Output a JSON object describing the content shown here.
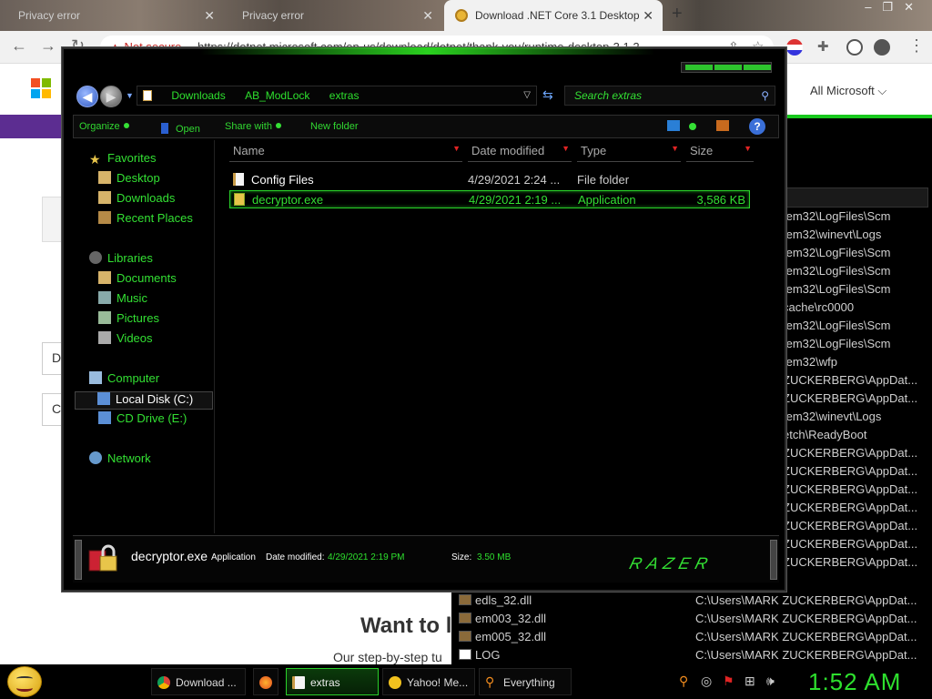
{
  "browser": {
    "tabs": [
      {
        "title": "Privacy error"
      },
      {
        "title": "Privacy error"
      },
      {
        "title": "Download .NET Core 3.1 Desktop"
      }
    ],
    "not_secure_label": "Not secure",
    "url": "https://dotnet.microsoft.com/en-us/download/dotnet/thank-you/runtime-desktop-3.1.2..."
  },
  "ms_page": {
    "all_microsoft": "All Microsoft",
    "box_letters": [
      "D",
      "C"
    ],
    "heading": "Want to l",
    "subtext": "Our step-by-step tu"
  },
  "bg_window": {
    "rows": [
      "tem32\\LogFiles\\Scm",
      "tem32\\winevt\\Logs",
      "tem32\\LogFiles\\Scm",
      "tem32\\LogFiles\\Scm",
      "tem32\\LogFiles\\Scm",
      "cache\\rc0000",
      "tem32\\LogFiles\\Scm",
      "tem32\\LogFiles\\Scm",
      "tem32\\wfp",
      "ZUCKERBERG\\AppDat...",
      "ZUCKERBERG\\AppDat...",
      "tem32\\winevt\\Logs",
      "etch\\ReadyBoot",
      "ZUCKERBERG\\AppDat...",
      "ZUCKERBERG\\AppDat...",
      "ZUCKERBERG\\AppDat...",
      "ZUCKERBERG\\AppDat...",
      "ZUCKERBERG\\AppDat...",
      "ZUCKERBERG\\AppDat...",
      "ZUCKERBERG\\AppDat..."
    ],
    "list": [
      {
        "name": "edls_32.dll",
        "path": "C:\\Users\\MARK ZUCKERBERG\\AppDat..."
      },
      {
        "name": "em003_32.dll",
        "path": "C:\\Users\\MARK ZUCKERBERG\\AppDat..."
      },
      {
        "name": "em005_32.dll",
        "path": "C:\\Users\\MARK ZUCKERBERG\\AppDat..."
      },
      {
        "name": "LOG",
        "path": "C:\\Users\\MARK ZUCKERBERG\\AppDat..."
      }
    ]
  },
  "explorer": {
    "breadcrumbs": [
      "Downloads",
      "AB_ModLock",
      "extras"
    ],
    "search_placeholder": "Search extras",
    "commands": {
      "organize": "Organize",
      "open": "Open",
      "share_with": "Share with",
      "new_folder": "New folder"
    },
    "nav": {
      "favorites": "Favorites",
      "desktop": "Desktop",
      "downloads": "Downloads",
      "recent_places": "Recent Places",
      "libraries": "Libraries",
      "documents": "Documents",
      "music": "Music",
      "pictures": "Pictures",
      "videos": "Videos",
      "computer": "Computer",
      "local_disk": "Local Disk (C:)",
      "cd_drive": "CD Drive (E:)",
      "network": "Network"
    },
    "columns": {
      "name": "Name",
      "date_modified": "Date modified",
      "type": "Type",
      "size": "Size"
    },
    "files": [
      {
        "name": "Config Files",
        "date": "4/29/2021 2:24 ...",
        "type": "File folder",
        "size": ""
      },
      {
        "name": "decryptor.exe",
        "date": "4/29/2021 2:19 ...",
        "type": "Application",
        "size": "3,586 KB"
      }
    ],
    "details": {
      "name": "decryptor.exe",
      "type": "Application",
      "date_label": "Date modified:",
      "date_value": "4/29/2021 2:19 PM",
      "size_label": "Size:",
      "size_value": "3.50 MB",
      "brand": "RAZER"
    }
  },
  "taskbar": {
    "buttons": [
      {
        "label": "Download ..."
      },
      {
        "label": "extras"
      },
      {
        "label": "Yahoo! Me..."
      },
      {
        "label": "Everything"
      }
    ],
    "clock": "1:52 AM"
  }
}
